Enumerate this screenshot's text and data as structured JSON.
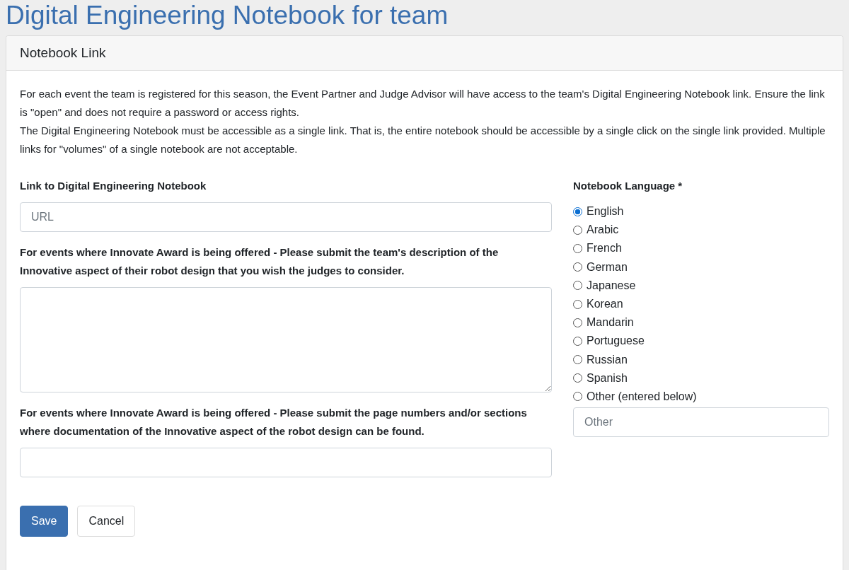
{
  "page_title": "Digital Engineering Notebook for team",
  "card": {
    "title": "Notebook Link",
    "intro": [
      "For each event the team is registered for this season, the Event Partner and Judge Advisor will have access to the team's Digital Engineering Notebook link. Ensure the link is \"open\" and does not require a password or access rights.",
      "The Digital Engineering Notebook must be accessible as a single link. That is, the entire notebook should be accessible by a single click on the single link provided. Multiple links for \"volumes\" of a single notebook are not acceptable."
    ],
    "fields": [
      {
        "kind": "input",
        "label": "Link to Digital Engineering Notebook",
        "placeholder": "URL"
      },
      {
        "kind": "textarea",
        "label": "For events where Innovate Award is being offered - Please submit the team's description of the Innovative aspect of their robot design that you wish the judges to consider."
      },
      {
        "kind": "input",
        "label": "For events where Innovate Award is being offered - Please submit the page numbers and/or sections where documentation of the Innovative aspect of the robot design can be found."
      }
    ],
    "language": {
      "label": "Notebook Language *",
      "options": [
        {
          "label": "English",
          "selected": true
        },
        {
          "label": "Arabic",
          "selected": false
        },
        {
          "label": "French",
          "selected": false
        },
        {
          "label": "German",
          "selected": false
        },
        {
          "label": "Japanese",
          "selected": false
        },
        {
          "label": "Korean",
          "selected": false
        },
        {
          "label": "Mandarin",
          "selected": false
        },
        {
          "label": "Portuguese",
          "selected": false
        },
        {
          "label": "Russian",
          "selected": false
        },
        {
          "label": "Spanish",
          "selected": false
        },
        {
          "label": "Other (entered below)",
          "selected": false
        }
      ],
      "other_placeholder": "Other"
    },
    "buttons": [
      {
        "kind": "primary",
        "label": "Save"
      },
      {
        "kind": "secondary",
        "label": "Cancel"
      }
    ]
  }
}
